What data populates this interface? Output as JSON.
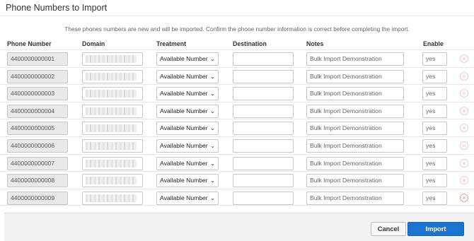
{
  "dialog": {
    "title": "Phone Numbers to Import",
    "intro": "These phones numbers are new and will be imported. Confirm the phone number information is correct before completing the import."
  },
  "columns": {
    "phone": "Phone Number",
    "domain": "Domain",
    "treatment": "Treatment",
    "destination": "Destination",
    "notes": "Notes",
    "enable": "Enable"
  },
  "rows": [
    {
      "phone": "4400000000001",
      "domain": "",
      "treatment": "Available Number",
      "destination": "",
      "notes": "Bulk Import Demonstration",
      "enable": "yes"
    },
    {
      "phone": "4400000000002",
      "domain": "",
      "treatment": "Available Number",
      "destination": "",
      "notes": "Bulk Import Demonstration",
      "enable": "yes"
    },
    {
      "phone": "4400000000003",
      "domain": "",
      "treatment": "Available Number",
      "destination": "",
      "notes": "Bulk Import Demonstration",
      "enable": "yes"
    },
    {
      "phone": "4400000000004",
      "domain": "",
      "treatment": "Available Number",
      "destination": "",
      "notes": "Bulk Import Demonstration",
      "enable": "yes"
    },
    {
      "phone": "4400000000005",
      "domain": "",
      "treatment": "Available Number",
      "destination": "",
      "notes": "Bulk Import Demonstration",
      "enable": "yes"
    },
    {
      "phone": "4400000000006",
      "domain": "",
      "treatment": "Available Number",
      "destination": "",
      "notes": "Bulk Import Demonstration",
      "enable": "yes"
    },
    {
      "phone": "4400000000007",
      "domain": "",
      "treatment": "Available Number",
      "destination": "",
      "notes": "Bulk Import Demonstration",
      "enable": "yes"
    },
    {
      "phone": "4400000000008",
      "domain": "",
      "treatment": "Available Number",
      "destination": "",
      "notes": "Bulk Import Demonstration",
      "enable": "yes"
    },
    {
      "phone": "4400000000009",
      "domain": "",
      "treatment": "Available Number",
      "destination": "",
      "notes": "Bulk Import Demonstration",
      "enable": "yes"
    }
  ],
  "icons": {
    "treatment_caret": "chevron-down-icon",
    "remove_row": "remove-circle-icon"
  },
  "footer": {
    "cancel_label": "Cancel",
    "import_label": "Import"
  },
  "colors": {
    "primary": "#1a75d1",
    "remove_icon": "#e08a8a"
  }
}
